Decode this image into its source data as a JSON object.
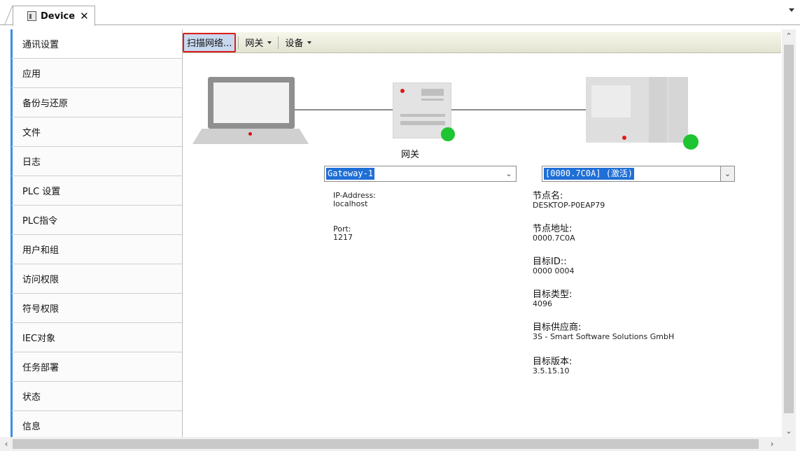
{
  "tab": {
    "title": "Device",
    "close_glyph": "✕",
    "icon": "device-icon"
  },
  "nav": {
    "items": [
      {
        "label": "通讯设置"
      },
      {
        "label": "应用"
      },
      {
        "label": "备份与还原"
      },
      {
        "label": "文件"
      },
      {
        "label": "日志"
      },
      {
        "label": "PLC 设置"
      },
      {
        "label": "PLC指令"
      },
      {
        "label": "用户和组"
      },
      {
        "label": "访问权限"
      },
      {
        "label": "符号权限"
      },
      {
        "label": "IEC对象"
      },
      {
        "label": "任务部署"
      },
      {
        "label": "状态"
      },
      {
        "label": "信息"
      }
    ],
    "active_index": 0
  },
  "toolbar": {
    "scan_label": "扫描网络...",
    "gateway_label": "网关",
    "device_label": "设备"
  },
  "gateway": {
    "label": "网关",
    "selected": "Gateway-1",
    "ip_label": "IP-Address:",
    "ip_value": "localhost",
    "port_label": "Port:",
    "port_value": "1217",
    "status_color": "#1ec431"
  },
  "device": {
    "selected": "[0000.7C0A] (激活)",
    "node_name_label": "节点名:",
    "node_name_value": "DESKTOP-P0EAP79",
    "node_addr_label": "节点地址:",
    "node_addr_value": "0000.7C0A",
    "target_id_label": "目标ID::",
    "target_id_value": "0000  0004",
    "target_type_label": "目标类型:",
    "target_type_value": "4096",
    "vendor_label": "目标供应商:",
    "vendor_value": "3S - Smart Software Solutions GmbH",
    "version_label": "目标版本:",
    "version_value": "3.5.15.10",
    "status_color": "#1ec431"
  },
  "colors": {
    "accent": "#3a8ee6",
    "highlight": "#e01c1c",
    "selection": "#1f6fd6"
  }
}
